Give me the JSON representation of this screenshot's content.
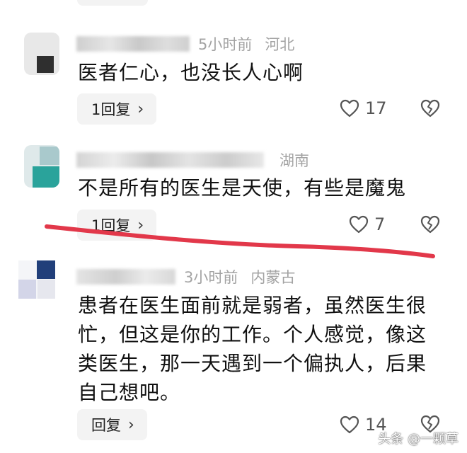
{
  "comments": [
    {
      "time": "5小时前",
      "location": "河北",
      "text": "医者仁心，也没长人心啊",
      "reply_label": "1回复",
      "likes": "17"
    },
    {
      "time": "",
      "location": "湖南",
      "text": "不是所有的医生是天使，有些是魔鬼",
      "reply_label": "1回复",
      "likes": "7"
    },
    {
      "time": "3小时前",
      "location": "内蒙古",
      "text_lines": [
        "患者在医生面前就是弱者，虽然医生很",
        "忙，但这是你的工作。个人感觉，像这",
        "类医生，那一天遇到一个偏执人，后果",
        "自己想吧。"
      ],
      "reply_label": "回复",
      "likes": "14"
    }
  ],
  "watermark": "头条 @一颗草",
  "colors": {
    "annotation_red": "#e2384a",
    "reply_bg": "#f3f3f3",
    "meta_gray": "#a3a3a3"
  },
  "icons": {
    "like": "heart-outline-icon",
    "dislike": "broken-heart-icon",
    "reply_chevron": "chevron-right-icon"
  }
}
